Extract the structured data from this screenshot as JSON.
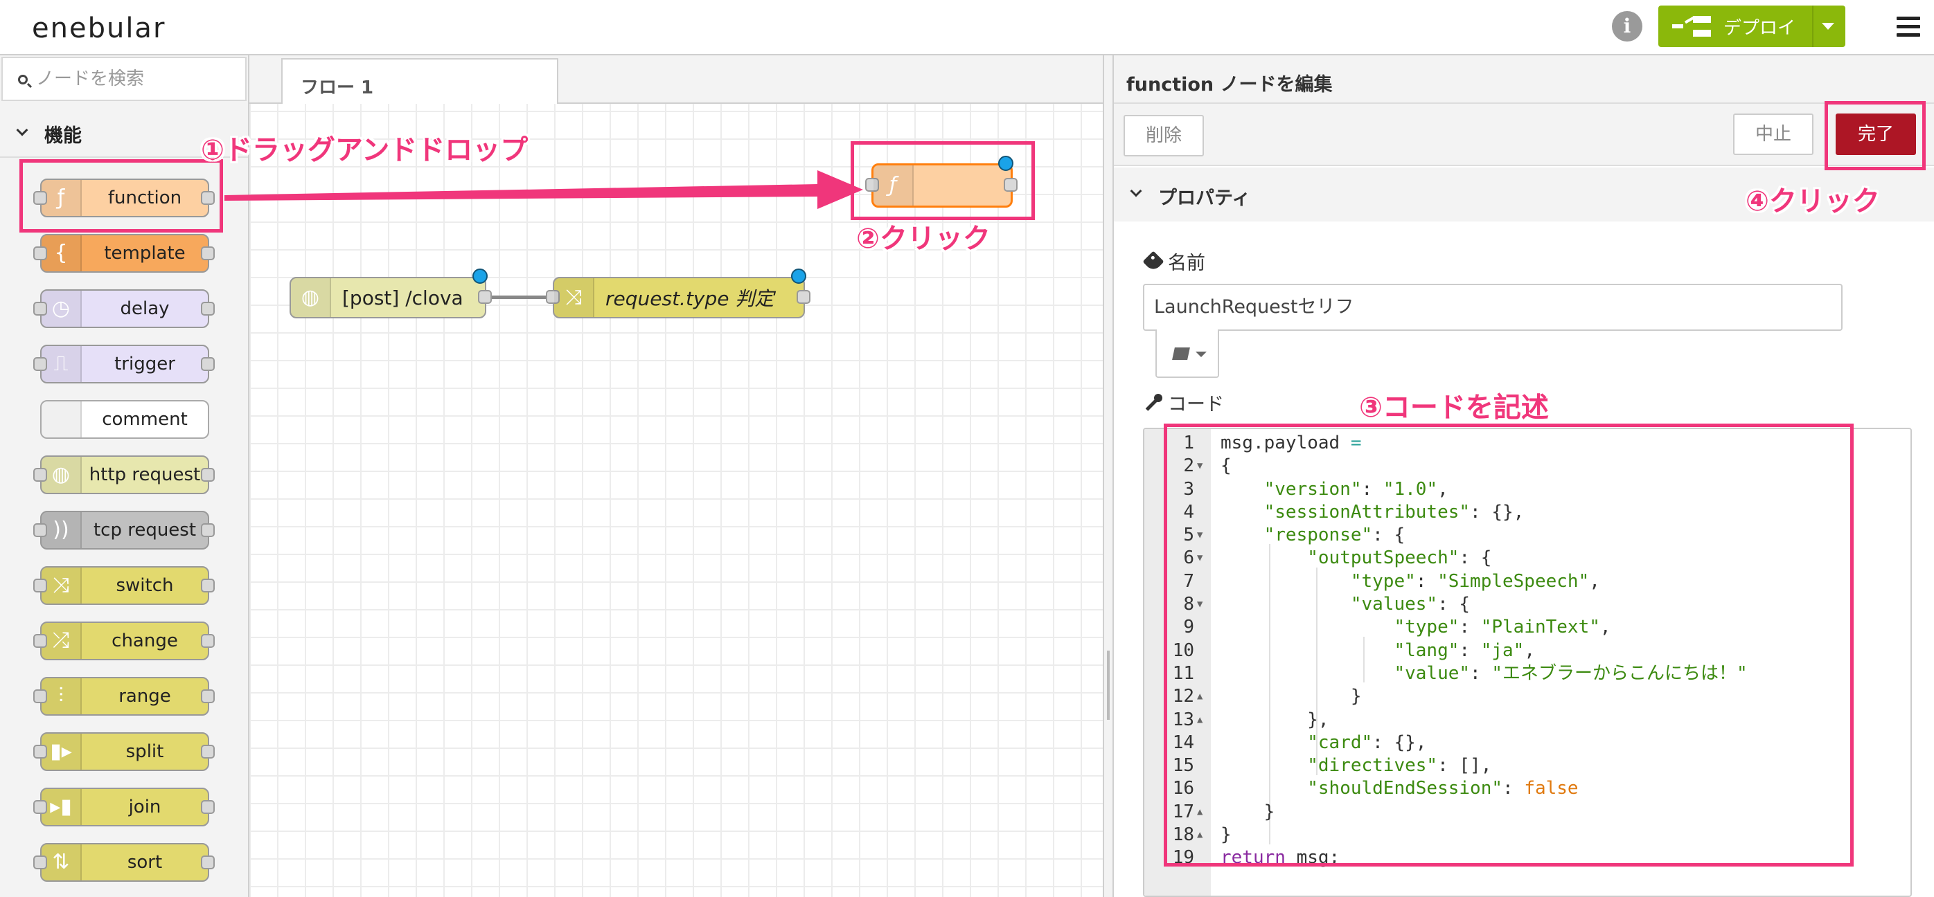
{
  "header": {
    "logo": "enebular",
    "deploy_label": "デプロイ"
  },
  "palette": {
    "search_placeholder": "ノードを検索",
    "category": "機能",
    "nodes": [
      {
        "label": "function",
        "icon": "ƒ",
        "color": "#fdd0a2"
      },
      {
        "label": "template",
        "icon": "{",
        "color": "#f7a85c"
      },
      {
        "label": "delay",
        "icon": "◷",
        "color": "#e6e0f8"
      },
      {
        "label": "trigger",
        "icon": "⎍",
        "color": "#e6e0f8"
      },
      {
        "label": "comment",
        "icon": "",
        "color": "#ffffff"
      },
      {
        "label": "http request",
        "icon": "◍",
        "color": "#e7e7ae"
      },
      {
        "label": "tcp request",
        "icon": "))",
        "color": "#c0c0c0"
      },
      {
        "label": "switch",
        "icon": "⤨",
        "color": "#e2d96e"
      },
      {
        "label": "change",
        "icon": "⤮",
        "color": "#e2d96e"
      },
      {
        "label": "range",
        "icon": "⫶",
        "color": "#e2d96e"
      },
      {
        "label": "split",
        "icon": "▮▸",
        "color": "#e2d96e"
      },
      {
        "label": "join",
        "icon": "▸▮",
        "color": "#e2d96e"
      },
      {
        "label": "sort",
        "icon": "⇅",
        "color": "#e2d96e"
      }
    ]
  },
  "workspace": {
    "tab": "フロー 1",
    "flow_nodes": [
      {
        "label": "[post] /clova",
        "icon": "◍",
        "color": "#e7e7ae"
      },
      {
        "label": "request.type 判定",
        "icon": "⤨",
        "color": "#e2d96e"
      },
      {
        "label": "",
        "icon": "ƒ",
        "color": "#fdd0a2"
      }
    ]
  },
  "editor": {
    "title": "function ノードを編集",
    "delete_label": "削除",
    "cancel_label": "中止",
    "done_label": "完了",
    "section": "プロパティ",
    "name_label": "名前",
    "name_value": "LaunchRequestセリフ",
    "code_label": "コード"
  },
  "annotations": {
    "step1": "①ドラッグアンドドロップ",
    "step2": "②クリック",
    "step3": "③コードを記述",
    "step4": "④クリック"
  },
  "colors": {
    "annotation": "#f0367b",
    "deploy": "#8bb80b",
    "done": "#ad1625"
  }
}
